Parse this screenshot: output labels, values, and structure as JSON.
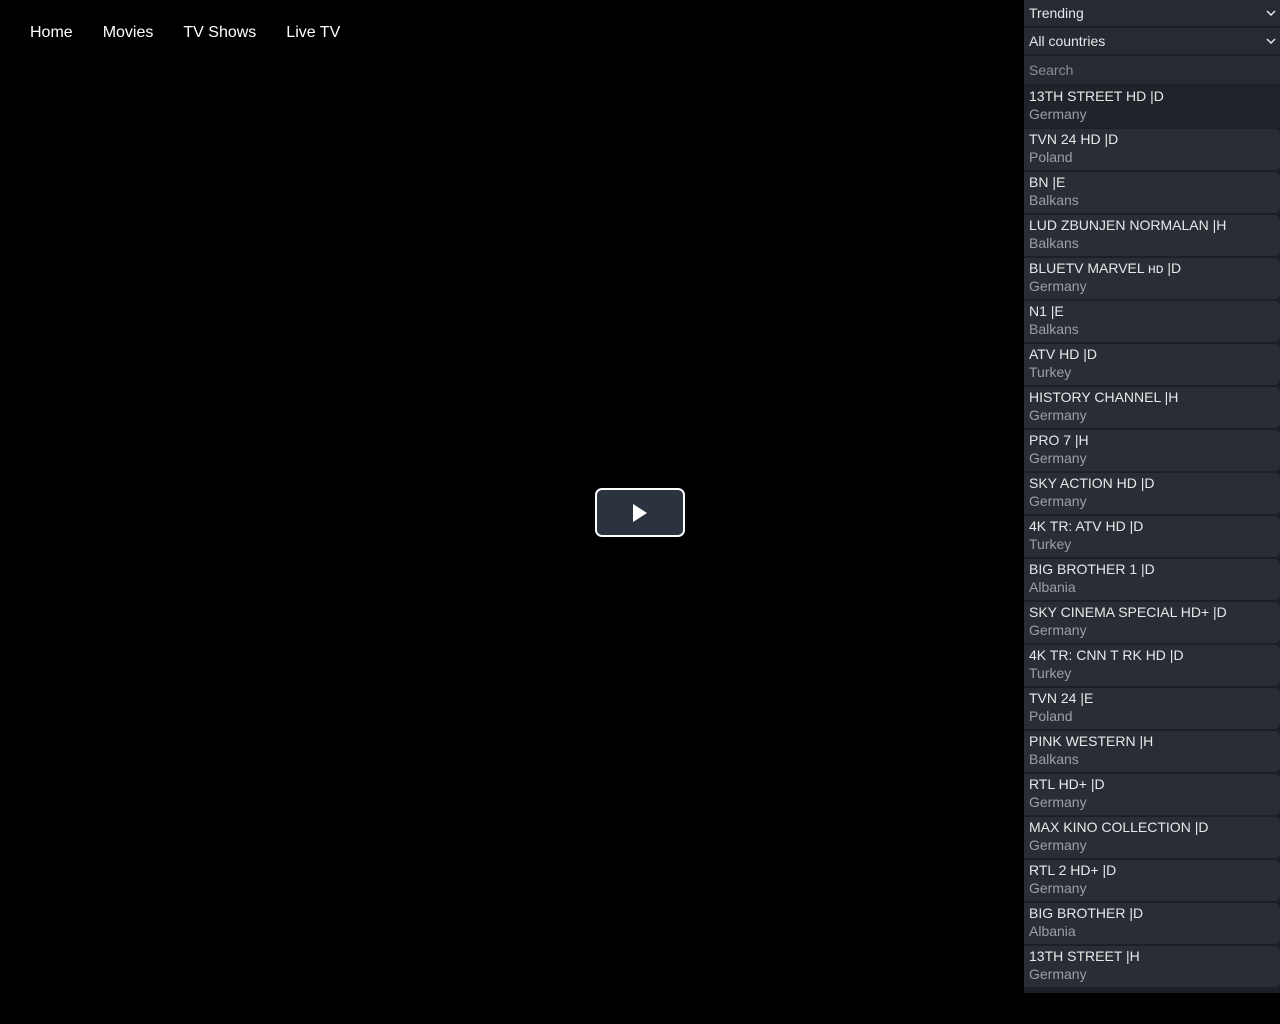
{
  "nav": {
    "items": [
      {
        "label": "Home"
      },
      {
        "label": "Movies"
      },
      {
        "label": "TV Shows"
      },
      {
        "label": "Live TV"
      }
    ]
  },
  "player": {
    "play_icon": "play-icon"
  },
  "filters": {
    "sort": {
      "selected": "Trending",
      "icon": "chevron-down-icon"
    },
    "country": {
      "selected": "All countries",
      "icon": "chevron-down-icon"
    },
    "search": {
      "placeholder": "Search",
      "value": ""
    }
  },
  "channels": [
    {
      "name": "13TH STREET HD |D",
      "country": "Germany"
    },
    {
      "name": "TVN 24 HD |D",
      "country": "Poland"
    },
    {
      "name": "BN |E",
      "country": "Balkans"
    },
    {
      "name": "LUD ZBUNJEN NORMALAN |H",
      "country": "Balkans"
    },
    {
      "name": "BLUETV MARVEL ʜᴅ |D",
      "country": "Germany"
    },
    {
      "name": "N1 |E",
      "country": "Balkans"
    },
    {
      "name": "ATV HD |D",
      "country": "Turkey"
    },
    {
      "name": "HISTORY CHANNEL |H",
      "country": "Germany"
    },
    {
      "name": "PRO 7 |H",
      "country": "Germany"
    },
    {
      "name": "SKY ACTION HD |D",
      "country": "Germany"
    },
    {
      "name": "4K TR: ATV HD |D",
      "country": "Turkey"
    },
    {
      "name": "BIG BROTHER 1 |D",
      "country": "Albania"
    },
    {
      "name": "SKY CINEMA SPECIAL HD+ |D",
      "country": "Germany"
    },
    {
      "name": "4K TR: CNN T RK HD |D",
      "country": "Turkey"
    },
    {
      "name": "TVN 24 |E",
      "country": "Poland"
    },
    {
      "name": "PINK WESTERN |H",
      "country": "Balkans"
    },
    {
      "name": "RTL HD+ |D",
      "country": "Germany"
    },
    {
      "name": "MAX KINO COLLECTION |D",
      "country": "Germany"
    },
    {
      "name": "RTL 2 HD+ |D",
      "country": "Germany"
    },
    {
      "name": "BIG BROTHER |D",
      "country": "Albania"
    },
    {
      "name": "13TH STREET |H",
      "country": "Germany"
    }
  ]
}
